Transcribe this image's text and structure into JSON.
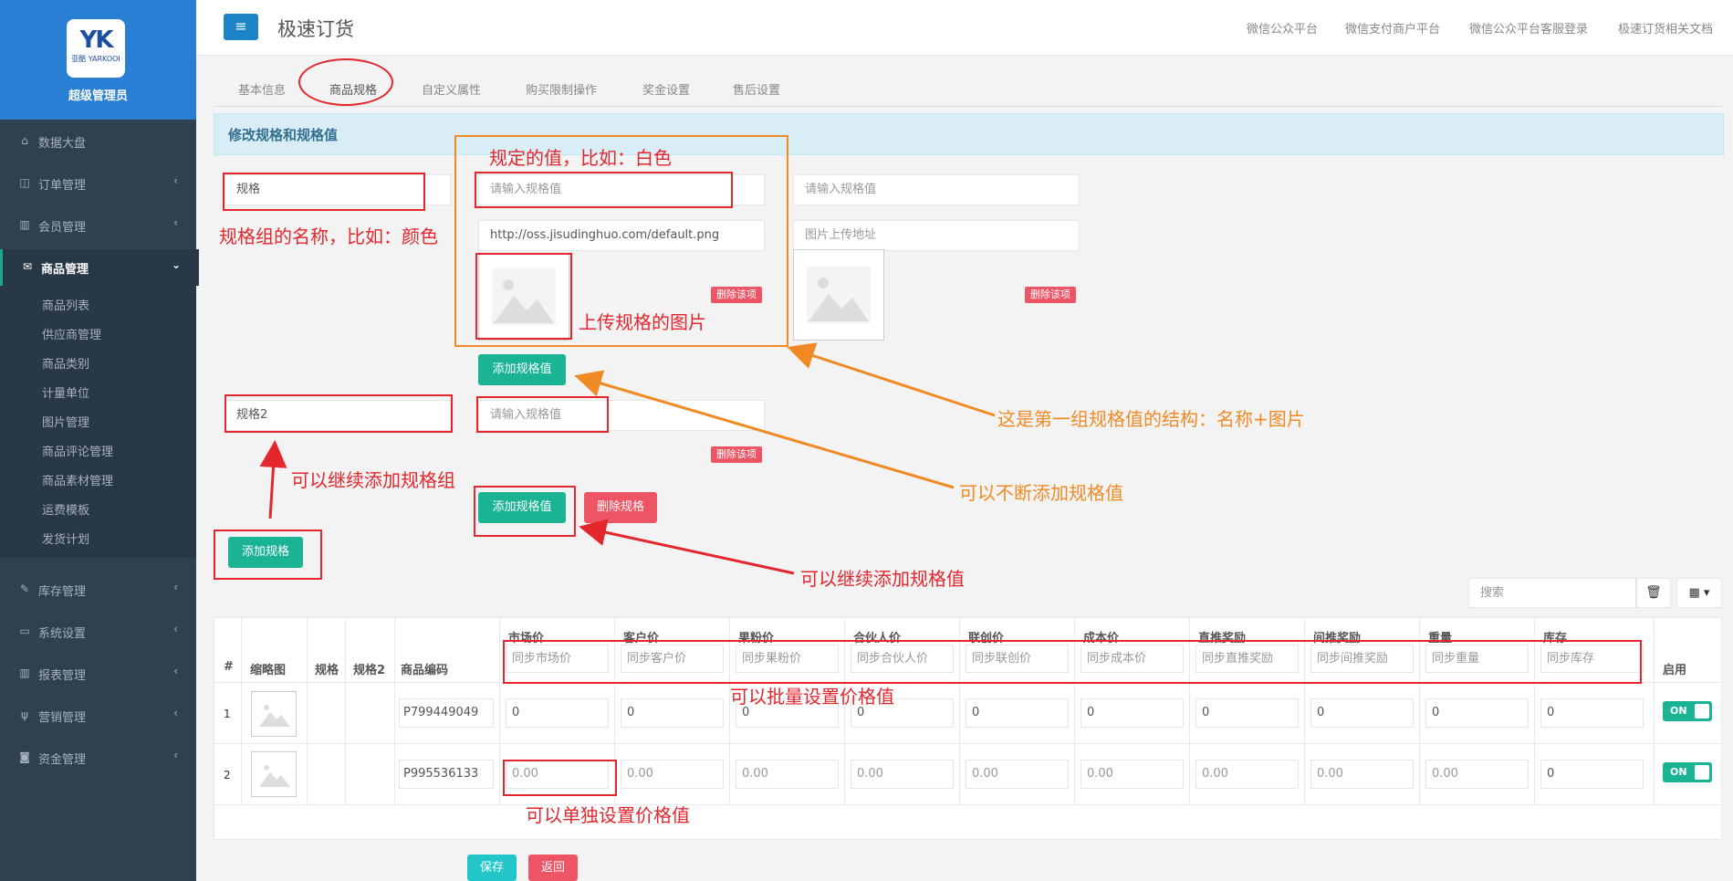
{
  "sidebar": {
    "logo_mark": "YK",
    "logo_sub": "亚酷 YARKOOI",
    "role": "超级管理员",
    "items": [
      {
        "label": "数据大盘",
        "icon": "home-icon"
      },
      {
        "label": "订单管理",
        "icon": "columns-icon"
      },
      {
        "label": "会员管理",
        "icon": "bar-chart-icon"
      },
      {
        "label": "商品管理",
        "icon": "envelope-icon"
      },
      {
        "label": "库存管理",
        "icon": "edit-icon"
      },
      {
        "label": "系统设置",
        "icon": "desktop-icon"
      },
      {
        "label": "报表管理",
        "icon": "bar-chart-icon"
      },
      {
        "label": "营销管理",
        "icon": "cutlery-icon"
      },
      {
        "label": "资金管理",
        "icon": "money-icon"
      }
    ],
    "sub_items": [
      "商品列表",
      "供应商管理",
      "商品类别",
      "计量单位",
      "图片管理",
      "商品评论管理",
      "商品素材管理",
      "运费模板",
      "发货计划"
    ]
  },
  "topbar": {
    "menu_icon": "≡",
    "title": "极速订货",
    "links": [
      "微信公众平台",
      "微信支付商户平台",
      "微信公众平台客服登录",
      "极速订货相关文档"
    ]
  },
  "tabs": [
    "基本信息",
    "商品规格",
    "自定义属性",
    "购买限制操作",
    "奖金设置",
    "售后设置"
  ],
  "panel_title": "修改规格和规格值",
  "spec1": {
    "name": "规格",
    "value_placeholder": "请输入规格值",
    "value2_placeholder": "请输入规格值",
    "image_url": "http://oss.jisudinghuo.com/default.png",
    "image_url_placeholder": "图片上传地址",
    "delete_item": "删除该项",
    "add_value": "添加规格值"
  },
  "spec2": {
    "name": "规格2",
    "value_placeholder": "请输入规格值",
    "delete_item": "删除该项",
    "add_value": "添加规格值",
    "delete_spec": "删除规格"
  },
  "add_spec": "添加规格",
  "search_placeholder": "搜索",
  "annotations": {
    "spec_value_example": "规定的值，比如：白色",
    "spec_group_name": "规格组的名称，比如：颜色",
    "upload_image": "上传规格的图片",
    "structure": "这是第一组规格值的结构：名称+图片",
    "keep_adding_group": "可以继续添加规格组",
    "keep_adding_values": "可以不断添加规格值",
    "continue_adding_value": "可以继续添加规格值",
    "batch_price": "可以批量设置价格值",
    "single_price": "可以单独设置价格值"
  },
  "table": {
    "headers": [
      "#",
      "缩略图",
      "规格",
      "规格2",
      "商品编码"
    ],
    "price_columns": [
      {
        "label": "市场价",
        "placeholder": "同步市场价"
      },
      {
        "label": "客户价",
        "placeholder": "同步客户价"
      },
      {
        "label": "果粉价",
        "placeholder": "同步果粉价"
      },
      {
        "label": "合伙人价",
        "placeholder": "同步合伙人价"
      },
      {
        "label": "联创价",
        "placeholder": "同步联创价"
      },
      {
        "label": "成本价",
        "placeholder": "同步成本价"
      },
      {
        "label": "直推奖励",
        "placeholder": "同步直推奖励"
      },
      {
        "label": "间推奖励",
        "placeholder": "同步间推奖励"
      },
      {
        "label": "重量",
        "placeholder": "同步重量"
      },
      {
        "label": "库存",
        "placeholder": "同步库存"
      }
    ],
    "enable_header": "启用",
    "rows": [
      {
        "num": "1",
        "code": "P799449049",
        "values": [
          "0",
          "0",
          "0",
          "0",
          "0",
          "0",
          "0",
          "0",
          "0",
          "0"
        ],
        "toggle": "ON"
      },
      {
        "num": "2",
        "code": "P995536133",
        "values": [
          "0.00",
          "0.00",
          "0.00",
          "0.00",
          "0.00",
          "0.00",
          "0.00",
          "0.00",
          "0.00",
          "0"
        ],
        "toggle": "ON"
      }
    ]
  },
  "footer": {
    "save": "保存",
    "back": "返回"
  }
}
